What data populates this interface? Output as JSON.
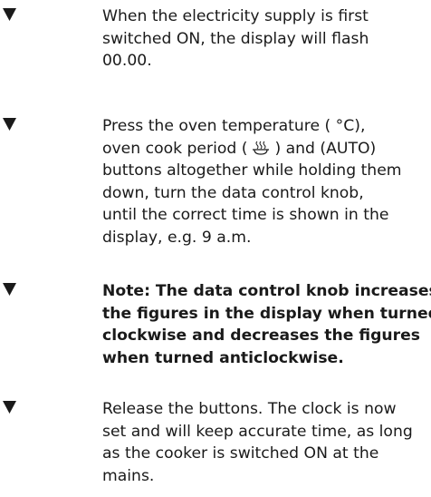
{
  "instructions": [
    {
      "lines": [
        "When the electricity supply is first",
        "switched ON, the display will flash",
        "00.00."
      ],
      "bold": false
    },
    {
      "lines": [
        "Press the oven temperature ( °C),",
        "oven cook period (  ꀎ  ) and (AUTO)",
        "buttons altogether while holding them",
        "down, turn the data control knob,",
        "until the correct time is shown in the",
        "display, e.g. 9 a.m."
      ],
      "bold": false
    },
    {
      "lines": [
        "Note: The data control knob increases",
        "the figures in the display when turned",
        "clockwise and decreases the figures",
        "when turned anticlockwise."
      ],
      "bold": true
    },
    {
      "lines": [
        "Release the buttons. The clock is now",
        "set and will keep accurate time, as long",
        "as the cooker is switched ON at the",
        "mains."
      ],
      "bold": false
    }
  ],
  "icons": {
    "bullet": "triangle-down-icon",
    "oven_cook_period": "steam-pot-icon"
  },
  "colors": {
    "text": "#1a1a1a",
    "bullet": "#1a1a1a",
    "background": "#ffffff"
  }
}
